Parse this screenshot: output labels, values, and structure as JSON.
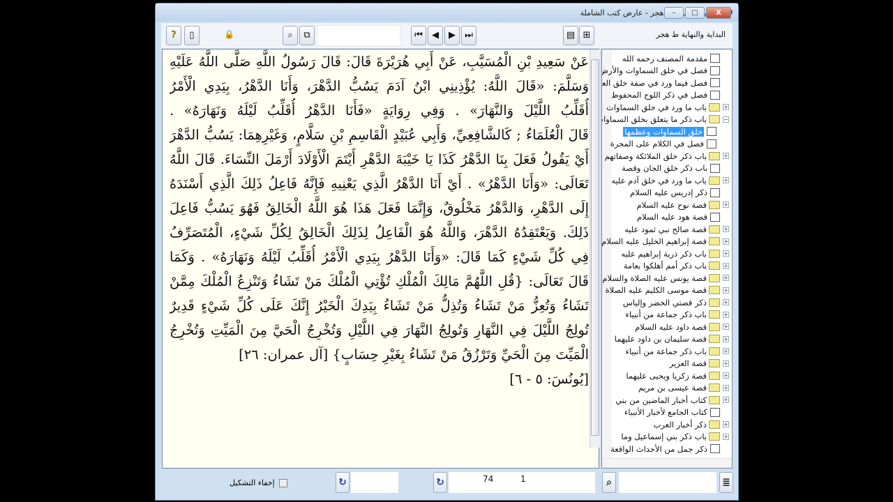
{
  "window": {
    "title": "البداية والنهاية ط هجر - عارض كتب الشاملة",
    "minimize": "–",
    "maximize": "□",
    "close": "X"
  },
  "toolbar": {
    "book_label": "البداية والنهاية ط هجر",
    "help": "?",
    "new": "▯",
    "lock": "🔒",
    "find": "⌕",
    "search_doc": "⧉",
    "first": "⏮",
    "prev": "◀",
    "next": "▶",
    "last": "⏭",
    "open": "▤",
    "tree": "⊞"
  },
  "content": {
    "lines": [
      "عَنْ سَعِيدِ بْنِ الْمُسَيَّبِ، عَنْ أَبِي هُرَيْرَةَ قَالَ: قَالَ رَسُولُ اللَّهِ صَلَّى اللَّهُ عَلَيْهِ",
      "وَسَلَّمَ: «قَالَ اللَّهُ: يُؤْذِينِي ابْنُ آدَمَ يَسُبُّ الدَّهْرَ، وَأَنَا الدَّهْرُ، بِيَدِي الْأَمْرُ",
      "أُقَلِّبُ اللَّيْلَ وَالنَّهَارَ» . وَفِي رِوَايَةٍ «فَأَنَا الدَّهْرُ أُقَلِّبُ لَيْلَهُ وَنَهَارَهُ» .",
      "قَالَ الْعُلَمَاءُ ; كَالشَّافِعِيِّ، وَأَبِي عُبَيْدٍ الْقَاسِمِ بْنِ سَلَّامٍ، وَغَيْرِهِمَا: يَسُبُّ الدَّهْرَ",
      "أَيْ يَقُولُ فَعَلَ بِنَا الدَّهْرُ كَذَا يَا خَيْبَةَ الدَّهْرِ أَيْتَمَ الْأَوْلَادَ أَرْمَلَ النِّسَاءَ. قَالَ اللَّهُ",
      "تَعَالَى: «وَأَنَا الدَّهْرُ» . أَيْ أَنَا الدَّهْرُ الَّذِي يَعْنِيهِ فَإِنَّهُ فَاعِلُ ذَلِكَ الَّذِي أَسْنَدَهُ",
      "إِلَى الدَّهْرِ، وَالدَّهْرُ مَخْلُوقٌ، وَإِنَّمَا فَعَلَ هَذَا هُوَ اللَّهُ الْخَالِقُ فَهُوَ يَسُبُّ فَاعِلَ",
      "ذَلِكَ. وَيَعْتَقِدُهُ الدَّهْرَ، وَاللَّهُ هُوَ الْفَاعِلُ لِذَلِكَ الْخَالِقُ لِكُلِّ شَيْءٍ، الْمُتَصَرِّفُ",
      "فِي كُلِّ شَيْءٍ كَمَا قَالَ: «وَأَنَا الدَّهْرُ بِيَدِي الْأَمْرُ أُقَلِّبُ لَيْلَهُ وَنَهَارَهُ» . وَكَمَا",
      "قَالَ تَعَالَى: {قُلِ اللَّهُمَّ مَالِكَ الْمُلْكِ تُؤْتِي الْمُلْكَ مَنْ تَشَاءُ وَتَنْزِعُ الْمُلْكَ مِمَّنْ",
      "تَشَاءُ وَتُعِزُّ مَنْ تَشَاءُ وَتُذِلُّ مَنْ تَشَاءُ بِيَدِكَ الْخَيْرُ إِنَّكَ عَلَى كُلِّ شَيْءٍ قَدِيرٌ",
      "تُولِجُ اللَّيْلَ فِي النَّهَارِ وَتُولِجُ النَّهَارَ فِي اللَّيْلِ وَتُخْرِجُ الْحَيَّ مِنَ الْمَيِّتِ وَتُخْرِجُ",
      "الْمَيِّتَ مِنَ الْحَيِّ وَتَرْزُقُ مَنْ تَشَاءُ بِغَيْرِ حِسَابٍ} [آل عمران: ٢٦]",
      "[يُونُسَ: ٥ - ٦]"
    ]
  },
  "tree": {
    "items": [
      {
        "label": "مقدمة المصنف رحمه الله",
        "type": "page"
      },
      {
        "label": "فصل في خلق السماوات والأرض",
        "type": "page"
      },
      {
        "label": "فصل فيما ورد في صفة خلق العرش",
        "type": "page"
      },
      {
        "label": "فصل في ذكر اللوح المحفوظ",
        "type": "page"
      },
      {
        "label": "باب ما ورد في خلق السماوات",
        "type": "folder"
      },
      {
        "label": "باب ذكر ما يتعلق بخلق السماوات",
        "type": "open"
      },
      {
        "label": "خلق السماوات وعظمها",
        "type": "child",
        "selected": true
      },
      {
        "label": "فصل في الكلام على المجرة",
        "type": "child"
      },
      {
        "label": "باب ذكر خلق الملائكة وصفاتهم",
        "type": "folder"
      },
      {
        "label": "باب ذكر خلق الجان وقصة",
        "type": "page"
      },
      {
        "label": "باب ما ورد في خلق آدم عليه",
        "type": "folder"
      },
      {
        "label": "ذكر إدريس عليه السلام",
        "type": "page"
      },
      {
        "label": "قصة نوح عليه السلام",
        "type": "folder"
      },
      {
        "label": "قصة هود عليه السلام",
        "type": "page"
      },
      {
        "label": "قصة صالح نبي ثمود عليه",
        "type": "folder"
      },
      {
        "label": "قصة إبراهيم الخليل عليه السلام",
        "type": "folder"
      },
      {
        "label": "باب ذكر ذرية إبراهيم عليه",
        "type": "folder"
      },
      {
        "label": "باب ذكر أمم أهلكوا بعامة",
        "type": "folder"
      },
      {
        "label": "قصة يونس عليه الصلاة والسلام",
        "type": "folder"
      },
      {
        "label": "قصة موسى الكليم عليه الصلاة",
        "type": "folder"
      },
      {
        "label": "ذكر قصتي الخضر وإلياس",
        "type": "folder"
      },
      {
        "label": "باب ذكر جماعة من أنبياء",
        "type": "folder"
      },
      {
        "label": "قصة داود عليه السلام",
        "type": "folder"
      },
      {
        "label": "قصة سليمان بن داود عليهما",
        "type": "folder"
      },
      {
        "label": "باب ذكر جماعة من أنبياء",
        "type": "folder"
      },
      {
        "label": "قصة العزير",
        "type": "folder"
      },
      {
        "label": "قصة زكريا ويحيى عليهما",
        "type": "folder"
      },
      {
        "label": "قصة عيسى بن مريم",
        "type": "folder"
      },
      {
        "label": "كتاب أخبار الماضين من بني",
        "type": "folder"
      },
      {
        "label": "كتاب الجامع لأخبار الأنبياء",
        "type": "page"
      },
      {
        "label": "ذكر أخبار العرب",
        "type": "folder"
      },
      {
        "label": "باب ذكر بني إسماعيل وما",
        "type": "folder"
      },
      {
        "label": "ذكر جمل من الأحداث الواقعة",
        "type": "page"
      }
    ]
  },
  "bottom": {
    "hide_diacritics_label": "إخفاء التشكيل",
    "page": "74",
    "part": "1",
    "refresh": "↻",
    "search": "⌕",
    "menu": "≣"
  }
}
